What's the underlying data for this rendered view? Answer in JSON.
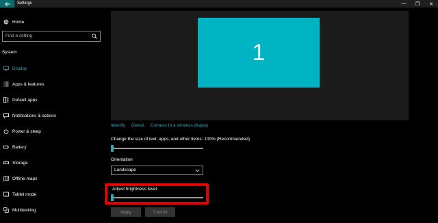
{
  "window": {
    "title": "Settings",
    "controls": [
      "—",
      "❐",
      "✕"
    ]
  },
  "sidebar": {
    "home_label": "Home",
    "search_placeholder": "Find a setting",
    "section_label": "System",
    "items": [
      {
        "label": "Display",
        "icon": "monitor-icon",
        "active": true
      },
      {
        "label": "Apps & features",
        "icon": "list-icon",
        "active": false
      },
      {
        "label": "Default apps",
        "icon": "default-apps-icon",
        "active": false
      },
      {
        "label": "Notifications & actions",
        "icon": "message-icon",
        "active": false
      },
      {
        "label": "Power & sleep",
        "icon": "power-icon",
        "active": false
      },
      {
        "label": "Battery",
        "icon": "battery-icon",
        "active": false
      },
      {
        "label": "Storage",
        "icon": "storage-icon",
        "active": false
      },
      {
        "label": "Offline maps",
        "icon": "map-icon",
        "active": false
      },
      {
        "label": "Tablet mode",
        "icon": "tablet-icon",
        "active": false
      },
      {
        "label": "Multitasking",
        "icon": "multitasking-icon",
        "active": false
      }
    ]
  },
  "main": {
    "monitor_number": "1",
    "links": {
      "identify": "Identify",
      "detect": "Detect",
      "wireless": "Connect to a wireless display"
    },
    "scale": {
      "label": "Change the size of text, apps, and other items: 100% (Recommended)",
      "value_fraction": 0.0
    },
    "orientation": {
      "label": "Orientation",
      "selected": "Landscape"
    },
    "brightness": {
      "label": "Adjust brightness level",
      "value_fraction": 0.0
    },
    "buttons": {
      "apply": "Apply",
      "cancel": "Cancel"
    }
  },
  "colors": {
    "accent": "#31a8b8",
    "monitor": "#00b4c4",
    "highlight": "#e00000",
    "titlebar_back": "#0e6b6b"
  }
}
